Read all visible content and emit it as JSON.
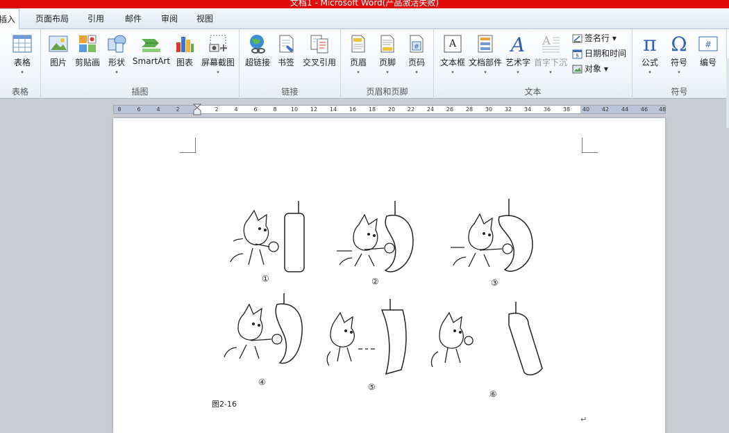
{
  "window": {
    "title": "文档1 - Microsoft Word(产品激活失败)"
  },
  "tabs": [
    {
      "label": "插入",
      "active": true
    },
    {
      "label": "页面布局"
    },
    {
      "label": "引用"
    },
    {
      "label": "邮件"
    },
    {
      "label": "审阅"
    },
    {
      "label": "视图"
    }
  ],
  "ribbon": {
    "groups": {
      "table": "表格",
      "illustrations": "插图",
      "links": "链接",
      "header_footer": "页眉和页脚",
      "text": "文本",
      "symbols": "符号"
    },
    "buttons": {
      "table": "表格",
      "picture": "图片",
      "clipart": "剪贴画",
      "shapes": "形状",
      "smartart": "SmartArt",
      "chart": "图表",
      "screenshot": "屏幕截图",
      "hyperlink": "超链接",
      "bookmark": "书签",
      "crossref": "交叉引用",
      "header": "页眉",
      "footer": "页脚",
      "page_number": "页码",
      "textbox": "文本框",
      "quickparts": "文档部件",
      "wordart": "艺术字",
      "dropcap": "首字下沉",
      "signature": "签名行",
      "datetime": "日期和时间",
      "object": "对象",
      "equation": "公式",
      "symbol": "符号",
      "numbering": "编号"
    },
    "dropdown_arrow": "▾"
  },
  "ruler": {
    "left_ticks": [
      "8",
      "6",
      "4",
      "2"
    ],
    "ticks": [
      "2",
      "4",
      "6",
      "8",
      "10",
      "12",
      "14",
      "16",
      "18",
      "20",
      "22",
      "24",
      "26",
      "28",
      "30",
      "32",
      "34",
      "36",
      "38",
      "40"
    ],
    "right_ticks": [
      "42",
      "44",
      "46",
      "48"
    ]
  },
  "document": {
    "captions": [
      "①",
      "②",
      "③",
      "④",
      "⑤",
      "⑥"
    ],
    "figure_label": "图2-16",
    "paragraph_mark": "↵"
  },
  "colors": {
    "title_bar": "#e00a0a",
    "ribbon_bg": "#f2f6fb",
    "workspace": "#c9ccd2"
  }
}
